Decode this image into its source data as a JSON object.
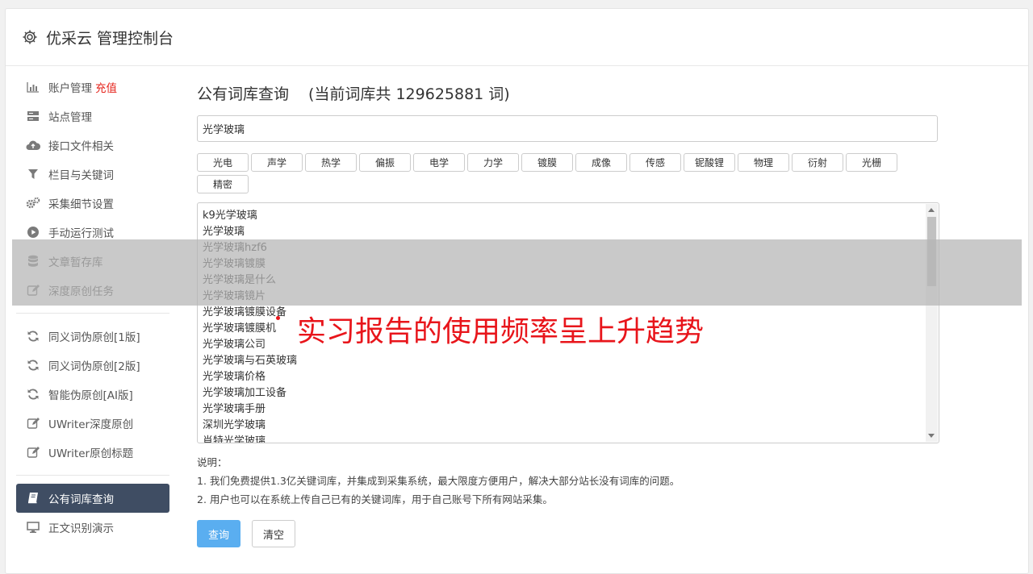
{
  "header": {
    "title": "优采云 管理控制台",
    "icon": "gear-icon"
  },
  "sidebar": {
    "group1": [
      {
        "label": "账户管理",
        "badge": "充值",
        "icon": "bar-chart-icon"
      },
      {
        "label": "站点管理",
        "icon": "server-icon"
      },
      {
        "label": "接口文件相关",
        "icon": "cloud-upload-icon"
      },
      {
        "label": "栏目与关键词",
        "icon": "filter-icon"
      },
      {
        "label": "采集细节设置",
        "icon": "cogs-icon"
      },
      {
        "label": "手动运行测试",
        "icon": "play-circle-icon"
      },
      {
        "label": "文章暂存库",
        "icon": "database-icon"
      },
      {
        "label": "深度原创任务",
        "icon": "edit-icon"
      }
    ],
    "group2": [
      {
        "label": "同义词伪原创[1版]",
        "icon": "refresh-icon"
      },
      {
        "label": "同义词伪原创[2版]",
        "icon": "refresh-icon"
      },
      {
        "label": "智能伪原创[AI版]",
        "icon": "refresh-icon"
      },
      {
        "label": "UWriter深度原创",
        "icon": "edit-icon"
      },
      {
        "label": "UWriter原创标题",
        "icon": "edit-icon"
      }
    ],
    "group3": [
      {
        "label": "公有词库查询",
        "icon": "book-icon",
        "active": true
      },
      {
        "label": "正文识别演示",
        "icon": "monitor-icon"
      }
    ]
  },
  "main": {
    "title": "公有词库查询",
    "count_text": "(当前词库共 129625881 词)",
    "search_value": "光学玻璃",
    "tags": [
      "光电",
      "声学",
      "热学",
      "偏振",
      "电学",
      "力学",
      "镀膜",
      "成像",
      "传感",
      "铌酸锂",
      "物理",
      "衍射",
      "光栅",
      "精密"
    ],
    "results": [
      "k9光学玻璃",
      "光学玻璃",
      "光学玻璃hzf6",
      "光学玻璃镀膜",
      "光学玻璃是什么",
      "光学玻璃镜片",
      "光学玻璃镀膜设备",
      "光学玻璃镀膜机",
      "光学玻璃公司",
      "光学玻璃与石英玻璃",
      "光学玻璃价格",
      "光学玻璃加工设备",
      "光学玻璃手册",
      "深圳光学玻璃",
      "肖特光学玻璃"
    ],
    "notes_title": "说明：",
    "notes": [
      "1. 我们免费提供1.3亿关键词库，并集成到采集系统，最大限度方便用户，解决大部分站长没有词库的问题。",
      "2. 用户也可以在系统上传自己已有的关键词库，用于自己账号下所有网站采集。"
    ],
    "query_button": "查询",
    "clear_button": "清空"
  },
  "overlay": {
    "text": "实习报告的使用频率呈上升趋势",
    "color": "#e8151b"
  }
}
